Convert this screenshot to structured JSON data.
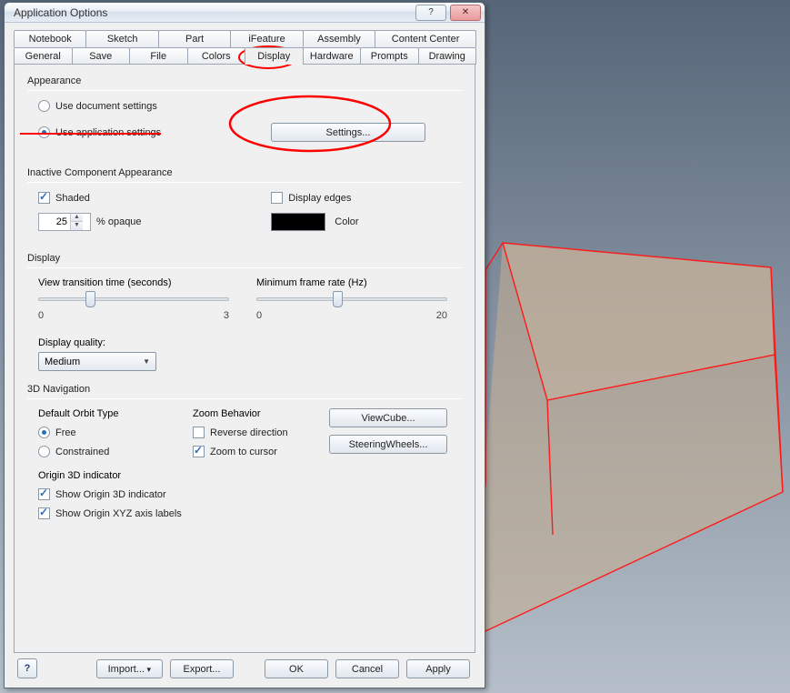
{
  "window": {
    "title": "Application Options"
  },
  "tabs_row1": [
    "Notebook",
    "Sketch",
    "Part",
    "iFeature",
    "Assembly",
    "Content Center"
  ],
  "tabs_row2": [
    "General",
    "Save",
    "File",
    "Colors",
    "Display",
    "Hardware",
    "Prompts",
    "Drawing"
  ],
  "appearance": {
    "section": "Appearance",
    "use_doc": "Use document settings",
    "use_app": "Use application settings",
    "settings_btn": "Settings..."
  },
  "inactive": {
    "section": "Inactive Component Appearance",
    "shaded": "Shaded",
    "opaque_value": "25",
    "opaque_label": "% opaque",
    "display_edges": "Display edges",
    "color_label": "Color",
    "color_hex": "#000000"
  },
  "display": {
    "section": "Display",
    "view_transition_label": "View transition time (seconds)",
    "view_min": "0",
    "view_max": "3",
    "min_frame_label": "Minimum frame rate (Hz)",
    "frame_min": "0",
    "frame_max": "20",
    "quality_label": "Display quality:",
    "quality_value": "Medium"
  },
  "nav": {
    "section": "3D Navigation",
    "orbit_label": "Default Orbit Type",
    "orbit_free": "Free",
    "orbit_constrained": "Constrained",
    "zoom_label": "Zoom Behavior",
    "zoom_reverse": "Reverse direction",
    "zoom_cursor": "Zoom to cursor",
    "viewcube_btn": "ViewCube...",
    "steering_btn": "SteeringWheels...",
    "origin_label": "Origin 3D indicator",
    "origin_show": "Show Origin 3D indicator",
    "origin_xyz": "Show Origin XYZ axis labels"
  },
  "footer": {
    "import": "Import...",
    "export": "Export...",
    "ok": "OK",
    "cancel": "Cancel",
    "apply": "Apply"
  }
}
